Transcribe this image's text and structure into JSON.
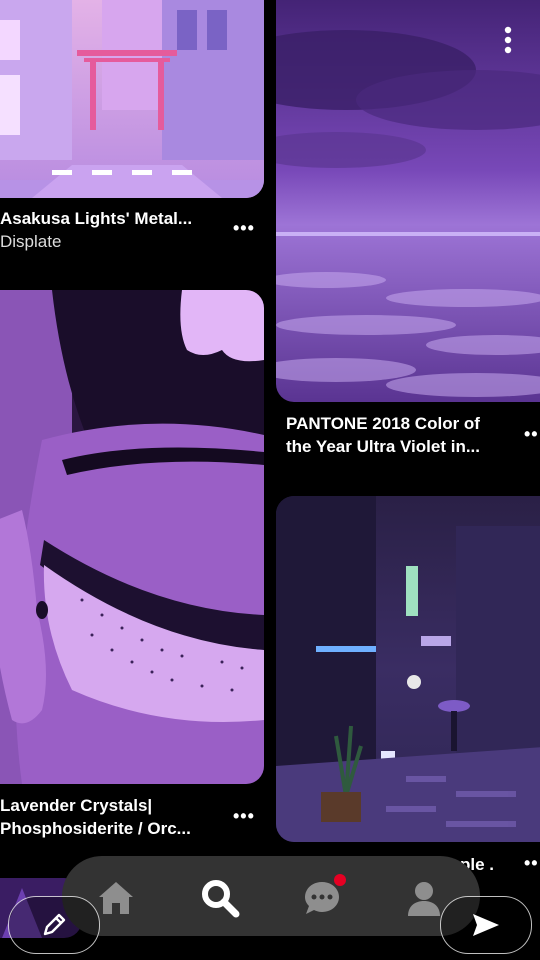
{
  "pins": [
    {
      "title": "Asakusa Lights' Metal...",
      "subtitle": "Displate",
      "more": "•••"
    },
    {
      "title_line1": "PANTONE 2018 Color of",
      "title_line2": "the Year Ultra Violet in...",
      "more": "••"
    },
    {
      "title_line1": "Lavender Crystals|",
      "title_line2": "Phosphosiderite / Orc...",
      "more": "•••"
    },
    {
      "title": "ple .",
      "more": "••"
    }
  ],
  "top_menu_icon": "vertical-dots-icon",
  "nav": {
    "items": [
      "home-icon",
      "search-icon",
      "messages-icon",
      "profile-icon"
    ],
    "notification_dot_color": "#e60023"
  },
  "float_buttons": {
    "left": "pencil-icon",
    "right": "send-icon"
  }
}
